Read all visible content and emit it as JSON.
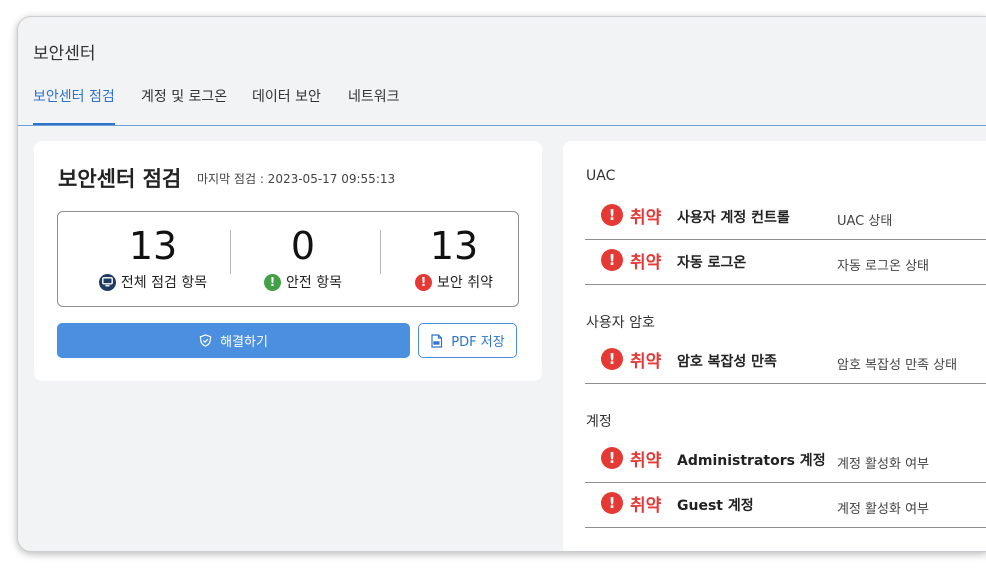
{
  "app": {
    "title": "보안센터"
  },
  "tabs": [
    {
      "label": "보안센터 점검",
      "active": true
    },
    {
      "label": "계정 및 로그온"
    },
    {
      "label": "데이터 보안"
    },
    {
      "label": "네트워크"
    }
  ],
  "summary": {
    "title": "보안센터 점검",
    "last_check": "마지막 점검 : 2023-05-17 09:55:13",
    "stats": [
      {
        "value": "13",
        "label": "전체 점검 항목",
        "icon": "monitor-icon"
      },
      {
        "value": "0",
        "label": "안전 항목",
        "icon": "exclamation-icon"
      },
      {
        "value": "13",
        "label": "보안 취약",
        "icon": "exclamation-icon"
      }
    ],
    "resolve_label": "해결하기",
    "pdf_label": "PDF 저장"
  },
  "sections": [
    {
      "title": "UAC",
      "items": [
        {
          "status": "취약",
          "name": "사용자 계정 컨트롤",
          "desc": "UAC 상태"
        },
        {
          "status": "취약",
          "name": "자동 로그온",
          "desc": "자동 로그온 상태"
        }
      ]
    },
    {
      "title": "사용자 암호",
      "items": [
        {
          "status": "취약",
          "name": "암호 복잡성 만족",
          "desc": "암호 복잡성 만족 상태"
        }
      ]
    },
    {
      "title": "계정",
      "items": [
        {
          "status": "취약",
          "name": "Administrators 계정",
          "desc": "계정 활성화 여부"
        },
        {
          "status": "취약",
          "name": "Guest 계정",
          "desc": "계정 활성화 여부"
        }
      ]
    }
  ],
  "colors": {
    "accent": "#2f74c9",
    "button": "#4a8fe0",
    "danger": "#e53935",
    "safe": "#43a047",
    "monitor": "#1f3b63"
  }
}
